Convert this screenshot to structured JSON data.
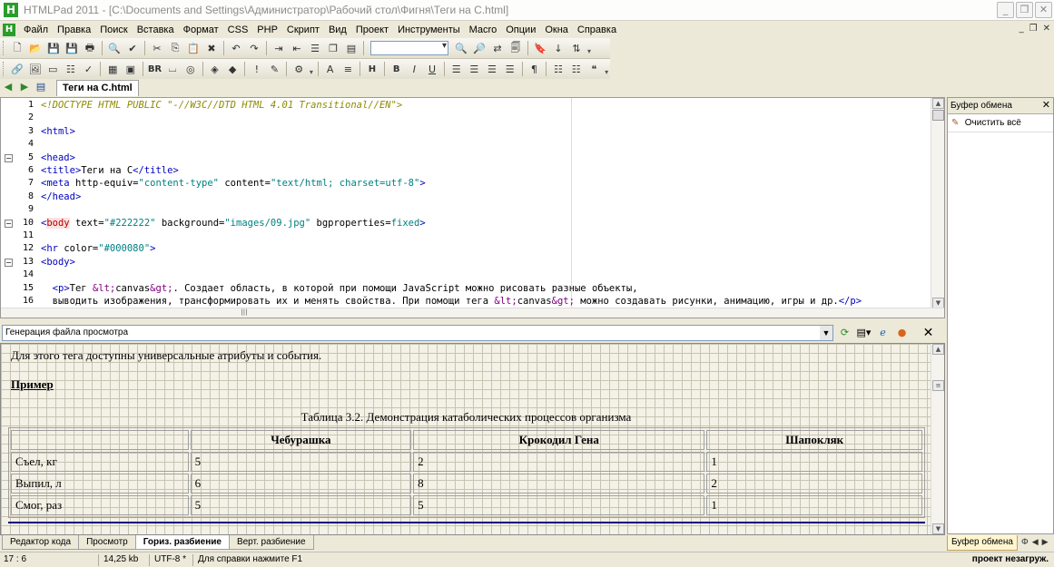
{
  "window": {
    "title": "HTMLPad 2011 - [C:\\Documents and Settings\\Администратор\\Рабочий стол\\Фигня\\Теги на C.html]",
    "app_icon": "H"
  },
  "menu": [
    "Файл",
    "Правка",
    "Поиск",
    "Вставка",
    "Формат",
    "CSS",
    "PHP",
    "Скрипт",
    "Вид",
    "Проект",
    "Инструменты",
    "Macro",
    "Опции",
    "Окна",
    "Справка"
  ],
  "toolbar2": {
    "br_label": "BR"
  },
  "toolbar3": {
    "bold_label": "B",
    "italic_label": "I",
    "underline_label": "U",
    "pilcrow_label": "¶"
  },
  "document_tab": "Теги на C.html",
  "editor": {
    "line_numbers": [
      "1",
      "2",
      "3",
      "4",
      "5",
      "6",
      "7",
      "8",
      "9",
      "10",
      "11",
      "12",
      "13",
      "14",
      "15",
      "16"
    ],
    "lines": [
      {
        "kind": "doctype",
        "text": "<!DOCTYPE HTML PUBLIC \"-//W3C//DTD HTML 4.01 Transitional//EN\">"
      },
      {
        "kind": "blank",
        "text": ""
      },
      {
        "kind": "tag",
        "text": "<html>"
      },
      {
        "kind": "blank",
        "text": ""
      },
      {
        "kind": "tag",
        "text": "<head>"
      },
      {
        "kind": "mixed",
        "text": "<title>Теги на C</title>"
      },
      {
        "kind": "mixed",
        "text": "<meta http-equiv=\"content-type\" content=\"text/html; charset=utf-8\">"
      },
      {
        "kind": "tag",
        "text": "</head>"
      },
      {
        "kind": "blank",
        "text": ""
      },
      {
        "kind": "body",
        "text": "<body text=\"#222222\" background=\"images/09.jpg\" bgproperties=fixed>"
      },
      {
        "kind": "blank",
        "text": ""
      },
      {
        "kind": "mixed",
        "text": "<hr color=\"#000080\">"
      },
      {
        "kind": "tag",
        "text": "<body>"
      },
      {
        "kind": "blank",
        "text": ""
      },
      {
        "kind": "mixed",
        "text": "  <p>Тег &lt;canvas&gt;. Создает область, в которой при помощи JavaScript можно рисовать разные объекты,"
      },
      {
        "kind": "mixed",
        "text": "  выводить изображения, трансформировать их и менять свойства. При помощи тега &lt;canvas&gt; можно создавать рисунки, анимацию, игры и др.</p>"
      }
    ]
  },
  "preview_header": {
    "label": "Генерация файла просмотра"
  },
  "preview": {
    "intro": "Для этого тега доступны универсальные атрибуты и события.",
    "example_heading": "Пример",
    "table_caption": "Таблица 3.2. Демонстрация катаболических процессов организма",
    "table_headers": [
      "",
      "Чебурашка",
      "Крокодил Гена",
      "Шапокляк"
    ],
    "table_rows": [
      [
        "Съел, кг",
        "5",
        "2",
        "1"
      ],
      [
        "Выпил, л",
        "6",
        "8",
        "2"
      ],
      [
        "Смог, раз",
        "5",
        "5",
        "1"
      ]
    ]
  },
  "view_tabs": [
    "Редактор кода",
    "Просмотр",
    "Гориз. разбиение",
    "Верт. разбиение"
  ],
  "active_view_tab": 2,
  "right_panel": {
    "title": "Буфер обмена",
    "clear_all": "Очистить всё",
    "bottom_tab": "Буфер обмена"
  },
  "status": {
    "position": "17 : 6",
    "size": "14,25 kb",
    "encoding": "UTF-8 *",
    "help": "Для справки нажмите F1",
    "project": "проект незагруж."
  }
}
